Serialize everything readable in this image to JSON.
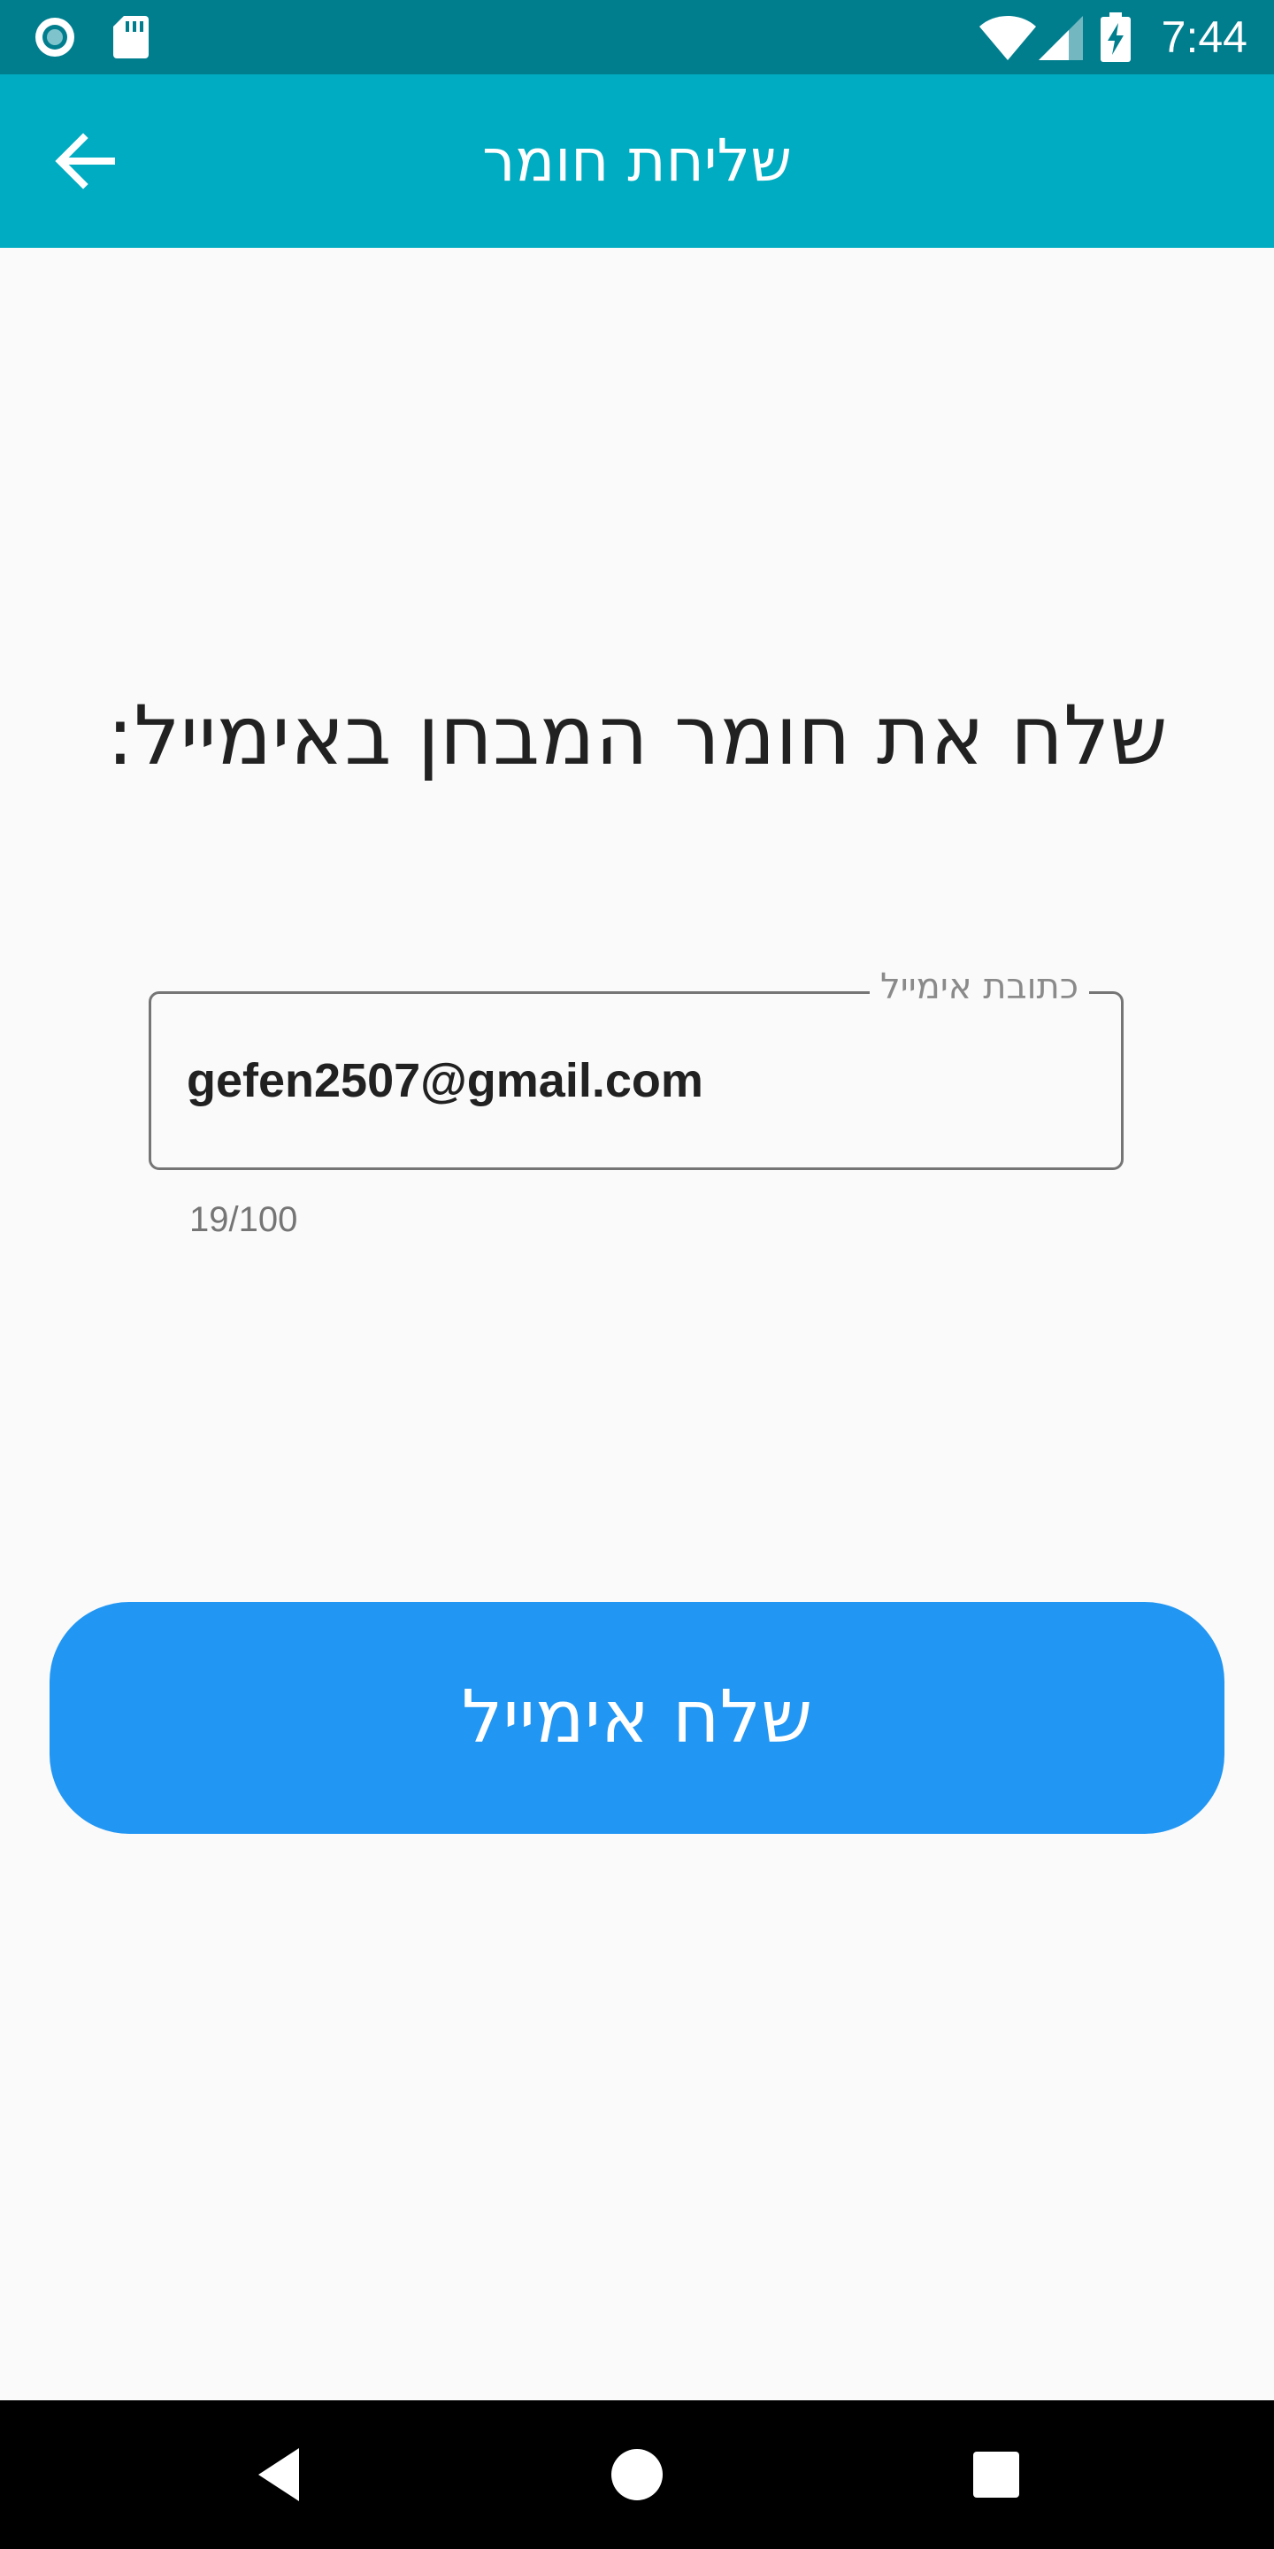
{
  "status_bar": {
    "time": "7:44",
    "icons": [
      "sync-icon",
      "sd-card-icon",
      "wifi-icon",
      "signal-icon",
      "battery-charging-icon"
    ]
  },
  "app_bar": {
    "title": "שליחת חומר",
    "back_icon": "arrow-back-icon"
  },
  "main": {
    "heading": "שלח את חומר המבחן באימייל:",
    "email_field": {
      "label": "כתובת אימייל",
      "value": "gefen2507@gmail.com",
      "counter": "19/100"
    },
    "send_button": {
      "label": "שלח אימייל"
    }
  },
  "nav_bar": {
    "icons": [
      "back-triangle-icon",
      "home-circle-icon",
      "recents-square-icon"
    ]
  },
  "colors": {
    "status_bar": "#017E8E",
    "app_bar": "#00ACC1",
    "background": "#FAFAFA",
    "button": "#2196F3",
    "nav_bar": "#000000"
  }
}
